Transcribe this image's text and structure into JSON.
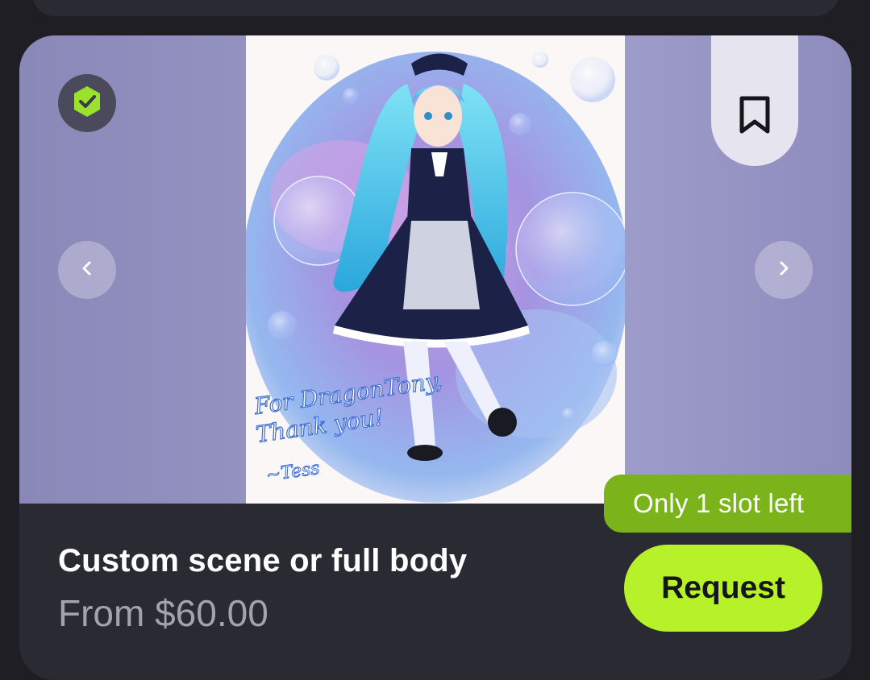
{
  "listing": {
    "title": "Custom scene or full body",
    "price": "From $60.00",
    "slot_notice": "Only 1 slot left",
    "request_label": "Request"
  },
  "artwork": {
    "caption_line1": "For DragonTony,",
    "caption_line2": "Thank you!",
    "signature": "~Tess"
  },
  "icons": {
    "verified": "verified-check-icon",
    "prev": "chevron-left-icon",
    "next": "chevron-right-icon",
    "bookmark": "bookmark-icon"
  },
  "colors": {
    "accent": "#b6f12a",
    "slot_badge": "#7bb41a",
    "card_bg": "#2a2a33",
    "page_bg": "#1e1e24"
  }
}
